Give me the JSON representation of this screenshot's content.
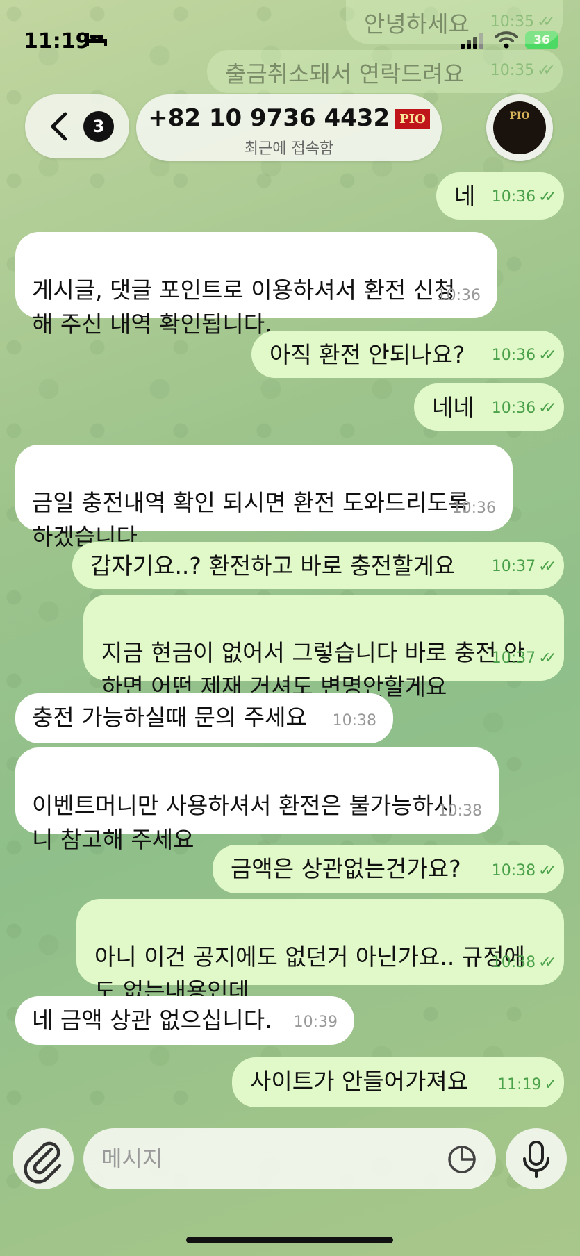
{
  "status_bar": {
    "time": "11:19",
    "battery": "36"
  },
  "header": {
    "unread_count": "3",
    "contact_name": "+82 10 9736 4432",
    "logo_text": "PIO",
    "status": "최근에 접속함"
  },
  "messages": [
    {
      "text": "안녕하세요",
      "time": "10:35",
      "dir": "out"
    },
    {
      "text": "출금취소돼서 연락드려요",
      "time": "10:35",
      "dir": "out"
    },
    {
      "text": "네",
      "time": "10:36",
      "dir": "out"
    },
    {
      "text": "게시글, 댓글 포인트로 이용하셔서 환전 신청\n해 주신 내역 확인됩니다.",
      "time": "10:36",
      "dir": "in"
    },
    {
      "text": "아직 환전 안되나요?",
      "time": "10:36",
      "dir": "out"
    },
    {
      "text": "네네",
      "time": "10:36",
      "dir": "out"
    },
    {
      "text": "금일 충전내역 확인 되시면 환전 도와드리도록\n하겠습니다.",
      "time": "10:36",
      "dir": "in"
    },
    {
      "text": "갑자기요..? 환전하고 바로 충전할게요",
      "time": "10:37",
      "dir": "out"
    },
    {
      "text": "지금 현금이 없어서 그렇습니다 바로 충전 안\n하면 어떤 제재 거셔도 변명안할게요",
      "time": "10:37",
      "dir": "out"
    },
    {
      "text": "충전 가능하실때 문의 주세요",
      "time": "10:38",
      "dir": "in"
    },
    {
      "text": "이벤트머니만 사용하셔서 환전은 불가능하시\n니 참고해 주세요",
      "time": "10:38",
      "dir": "in"
    },
    {
      "text": "금액은 상관없는건가요?",
      "time": "10:38",
      "dir": "out"
    },
    {
      "text": "아니 이건 공지에도 없던거 아닌가요.. 규정에\n도 없는내용인데",
      "time": "10:38",
      "dir": "out"
    },
    {
      "text": "네 금액 상관 없으십니다.",
      "time": "10:39",
      "dir": "in"
    },
    {
      "text": "사이트가 안들어가져요",
      "time": "11:19",
      "dir": "out"
    }
  ],
  "input": {
    "placeholder": "메시지"
  },
  "icons": {
    "back": "chevron-left-icon",
    "attach": "paperclip-icon",
    "sticker": "sticker-icon",
    "mic": "microphone-icon"
  },
  "colors": {
    "outgoing_bubble": "#e1f8c8",
    "incoming_bubble": "#ffffff",
    "check": "#4aa14a"
  }
}
